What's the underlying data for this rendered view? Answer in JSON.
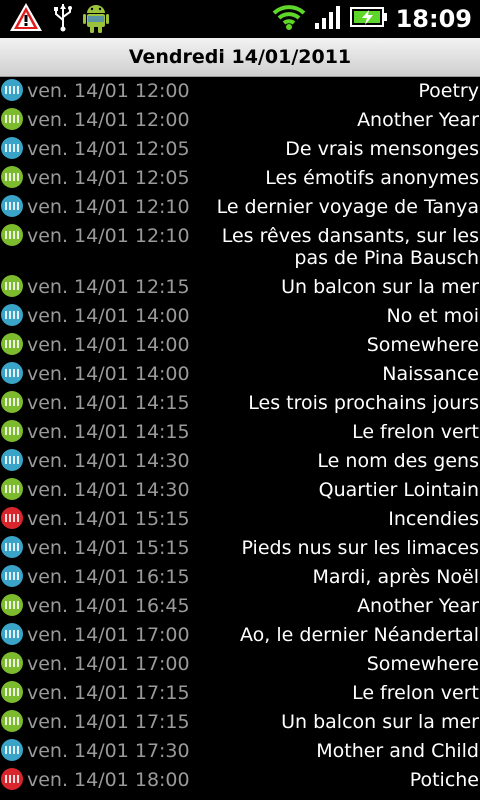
{
  "status_bar": {
    "icons_left": [
      "warning-icon",
      "usb-icon",
      "android-icon"
    ],
    "icons_right": [
      "wifi-icon",
      "signal-icon",
      "battery-charging-icon"
    ],
    "time": "18:09"
  },
  "header": {
    "title": "Vendredi 14/01/2011"
  },
  "rows": [
    {
      "time": "ven. 14/01 12:00",
      "title": "Poetry",
      "color": "#3aa3c8"
    },
    {
      "time": "ven. 14/01 12:00",
      "title": "Another Year",
      "color": "#7dbb2e"
    },
    {
      "time": "ven. 14/01 12:05",
      "title": "De vrais mensonges",
      "color": "#3aa3c8"
    },
    {
      "time": "ven. 14/01 12:05",
      "title": "Les émotifs anonymes",
      "color": "#7dbb2e"
    },
    {
      "time": "ven. 14/01 12:10",
      "title": "Le dernier voyage de Tanya",
      "color": "#3aa3c8"
    },
    {
      "time": "ven. 14/01 12:10",
      "title": "Les rêves dansants, sur les pas de Pina Bausch",
      "color": "#7dbb2e"
    },
    {
      "time": "ven. 14/01 12:15",
      "title": "Un balcon sur la mer",
      "color": "#7dbb2e"
    },
    {
      "time": "ven. 14/01 14:00",
      "title": "No et moi",
      "color": "#3aa3c8"
    },
    {
      "time": "ven. 14/01 14:00",
      "title": "Somewhere",
      "color": "#7dbb2e"
    },
    {
      "time": "ven. 14/01 14:00",
      "title": "Naissance",
      "color": "#3aa3c8"
    },
    {
      "time": "ven. 14/01 14:15",
      "title": "Les trois prochains jours",
      "color": "#7dbb2e"
    },
    {
      "time": "ven. 14/01 14:15",
      "title": "Le frelon vert",
      "color": "#7dbb2e"
    },
    {
      "time": "ven. 14/01 14:30",
      "title": "Le nom des gens",
      "color": "#3aa3c8"
    },
    {
      "time": "ven. 14/01 14:30",
      "title": "Quartier Lointain",
      "color": "#7dbb2e"
    },
    {
      "time": "ven. 14/01 15:15",
      "title": "Incendies",
      "color": "#d9262c"
    },
    {
      "time": "ven. 14/01 15:15",
      "title": "Pieds nus sur les limaces",
      "color": "#3aa3c8"
    },
    {
      "time": "ven. 14/01 16:15",
      "title": "Mardi, après Noël",
      "color": "#3aa3c8"
    },
    {
      "time": "ven. 14/01 16:45",
      "title": "Another Year",
      "color": "#7dbb2e"
    },
    {
      "time": "ven. 14/01 17:00",
      "title": "Ao, le dernier Néandertal",
      "color": "#3aa3c8"
    },
    {
      "time": "ven. 14/01 17:00",
      "title": "Somewhere",
      "color": "#7dbb2e"
    },
    {
      "time": "ven. 14/01 17:15",
      "title": "Le frelon vert",
      "color": "#7dbb2e"
    },
    {
      "time": "ven. 14/01 17:15",
      "title": "Un balcon sur la mer",
      "color": "#7dbb2e"
    },
    {
      "time": "ven. 14/01 17:30",
      "title": "Mother and Child",
      "color": "#3aa3c8"
    },
    {
      "time": "ven. 14/01 18:00",
      "title": "Potiche",
      "color": "#d9262c"
    }
  ]
}
